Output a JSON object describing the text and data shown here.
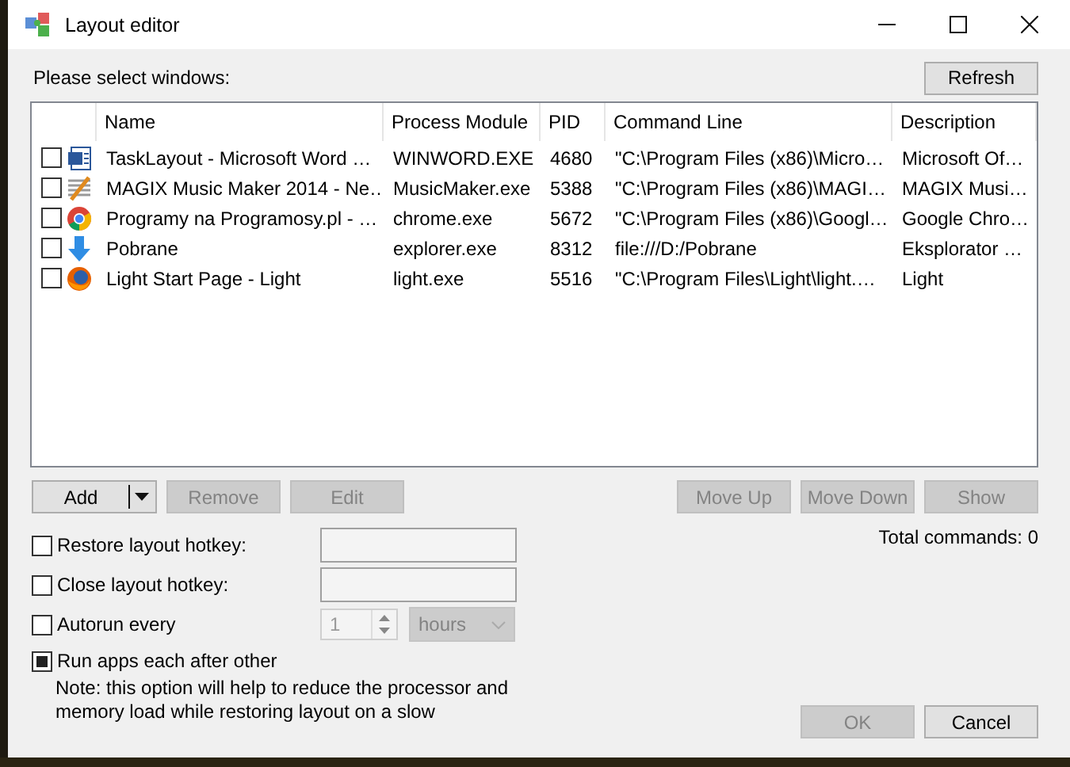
{
  "window": {
    "title": "Layout editor"
  },
  "prompt": "Please select windows:",
  "refresh_button": {
    "label": "Refresh",
    "disabled": false
  },
  "list": {
    "columns": [
      "Name",
      "Process Module",
      "PID",
      "Command Line",
      "Description"
    ],
    "rows": [
      {
        "checked": false,
        "name": "TaskLayout - Microsoft Word …",
        "process_module": "WINWORD.EXE",
        "pid": "4680",
        "command_line": "\"C:\\Program Files (x86)\\Micro…",
        "description": "Microsoft Of…"
      },
      {
        "checked": false,
        "name": "MAGIX Music Maker 2014 - Ne…",
        "process_module": "MusicMaker.exe",
        "pid": "5388",
        "command_line": "\"C:\\Program Files (x86)\\MAGI…",
        "description": "MAGIX Musi…"
      },
      {
        "checked": false,
        "name": "Programy na Programosy.pl - …",
        "process_module": "chrome.exe",
        "pid": "5672",
        "command_line": "\"C:\\Program Files (x86)\\Googl…",
        "description": "Google Chro…"
      },
      {
        "checked": false,
        "name": "Pobrane",
        "process_module": "explorer.exe",
        "pid": "8312",
        "command_line": "file:///D:/Pobrane",
        "description": "Eksplorator …"
      },
      {
        "checked": false,
        "name": "Light Start Page - Light",
        "process_module": "light.exe",
        "pid": "5516",
        "command_line": "\"C:\\Program Files\\Light\\light.…",
        "description": "Light"
      }
    ]
  },
  "left_buttons": [
    {
      "label": "Add",
      "kind": "split",
      "disabled": false
    },
    {
      "label": "Remove",
      "kind": "plain",
      "disabled": true
    },
    {
      "label": "Edit",
      "kind": "plain",
      "disabled": true
    }
  ],
  "right_buttons": [
    {
      "label": "Move Up",
      "disabled": true
    },
    {
      "label": "Move Down",
      "disabled": true
    },
    {
      "label": "Show",
      "disabled": true
    }
  ],
  "total_commands": "Total commands: 0",
  "options": [
    {
      "kind": "hotkey",
      "label": "Restore layout hotkey:",
      "checked": false
    },
    {
      "kind": "hotkey",
      "label": "Close layout hotkey:",
      "checked": false
    },
    {
      "kind": "autorun",
      "label": "Autorun every",
      "checked": false,
      "value": "1",
      "unit": "hours"
    },
    {
      "kind": "plain",
      "label": "Run apps each after other",
      "checked": true
    }
  ],
  "note": "Note: this option will help to reduce the processor and memory load while restoring layout on a slow",
  "dialog_buttons": [
    {
      "label": "OK",
      "disabled": true
    },
    {
      "label": "Cancel",
      "disabled": false
    }
  ]
}
